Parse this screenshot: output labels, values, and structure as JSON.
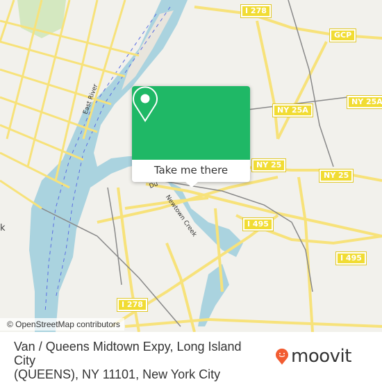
{
  "map": {
    "attribution": "© OpenStreetMap contributors",
    "labels": {
      "east_river": "East River",
      "newtown_creek": "Newtown Creek",
      "dutch_kills": "Du",
      "new_york_partial": "k"
    },
    "shields": [
      {
        "id": "i278-top",
        "text": "I 278"
      },
      {
        "id": "gcp",
        "text": "GCP"
      },
      {
        "id": "ny25a-left",
        "text": "NY 25A"
      },
      {
        "id": "ny25a-right",
        "text": "NY 25A"
      },
      {
        "id": "ny25-left",
        "text": "NY 25"
      },
      {
        "id": "ny25-right",
        "text": "NY 25"
      },
      {
        "id": "i495-left",
        "text": "I 495"
      },
      {
        "id": "i495-right",
        "text": "I 495"
      },
      {
        "id": "i278-bottom",
        "text": "I 278"
      }
    ],
    "colors": {
      "land": "#f2f1ec",
      "water": "#aad3df",
      "road": "#f7e27a",
      "park": "#d4e8c0"
    }
  },
  "popup": {
    "icon": "location-pin-icon",
    "button_label": "Take me there",
    "accent": "#1fb866"
  },
  "footer": {
    "address_line1": "Van / Queens Midtown Expy, Long Island City",
    "address_line2": "(QUEENS), NY 11101, New York City",
    "brand": "moovit",
    "brand_color": "#f25c31"
  }
}
